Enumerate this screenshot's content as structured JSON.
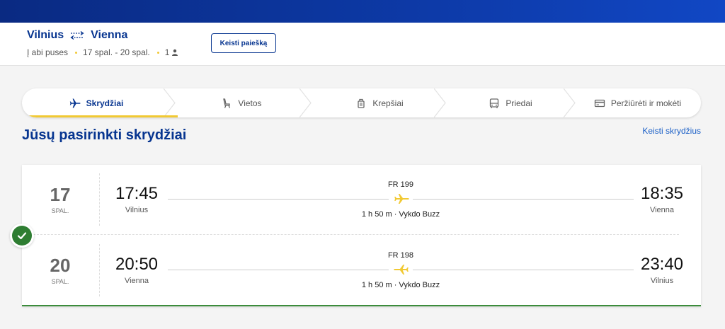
{
  "summary": {
    "origin": "Vilnius",
    "destination": "Vienna",
    "trip_type": "Į abi puses",
    "dates": "17 spal. - 20 spal.",
    "passengers": "1",
    "change_search": "Keisti paiešką"
  },
  "steps": [
    {
      "label": "Skrydžiai",
      "icon": "plane-icon",
      "active": true
    },
    {
      "label": "Vietos",
      "icon": "seat-icon",
      "active": false
    },
    {
      "label": "Krepšiai",
      "icon": "bag-icon",
      "active": false
    },
    {
      "label": "Priedai",
      "icon": "bus-icon",
      "active": false
    },
    {
      "label": "Peržiūrėti ir mokėti",
      "icon": "card-icon",
      "active": false
    }
  ],
  "page_title": "Jūsų pasirinkti skrydžiai",
  "change_flights": "Keisti skrydžius",
  "flights": [
    {
      "day": "17",
      "month": "SPAL.",
      "dep_time": "17:45",
      "dep_city": "Vilnius",
      "arr_time": "18:35",
      "arr_city": "Vienna",
      "flight_no": "FR 199",
      "info": "1 h 50 m · Vykdo Buzz"
    },
    {
      "day": "20",
      "month": "SPAL.",
      "dep_time": "20:50",
      "dep_city": "Vienna",
      "arr_time": "23:40",
      "arr_city": "Vilnius",
      "flight_no": "FR 198",
      "info": "1 h 50 m · Vykdo Buzz"
    }
  ],
  "colors": {
    "brand_blue": "#073590",
    "accent_yellow": "#f1c933",
    "success_green": "#2e7d32",
    "link_blue": "#1a5fc7"
  }
}
